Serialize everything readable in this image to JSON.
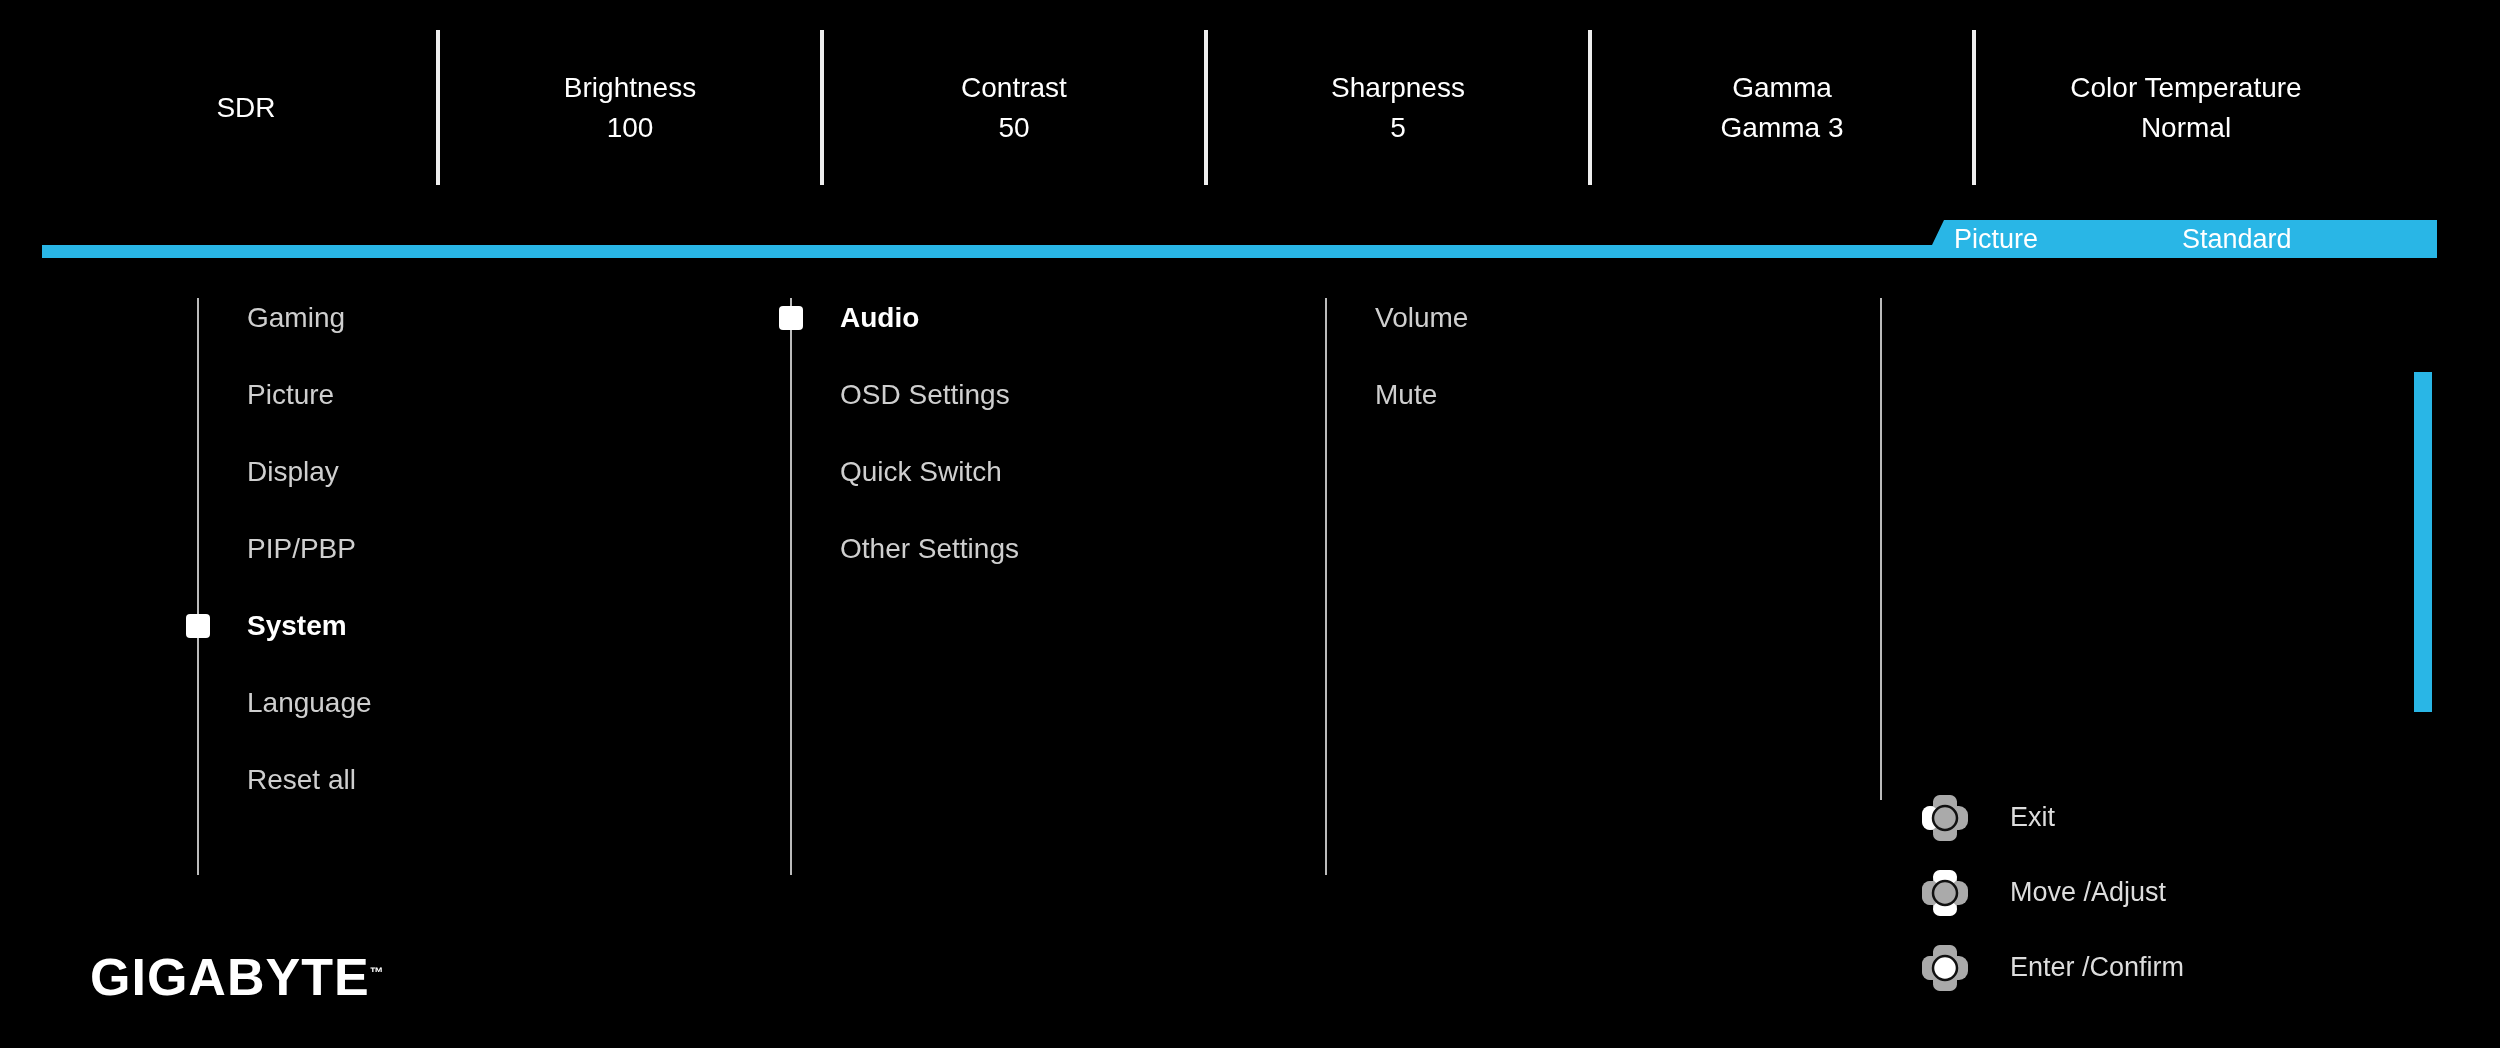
{
  "header": [
    {
      "label": "SDR"
    },
    {
      "label": "Brightness",
      "value": "100"
    },
    {
      "label": "Contrast",
      "value": "50"
    },
    {
      "label": "Sharpness",
      "value": "5"
    },
    {
      "label": "Gamma",
      "value": "Gamma 3"
    },
    {
      "label": "Color Temperature",
      "value": "Normal"
    }
  ],
  "mode_tab": {
    "label": "Picture",
    "value": "Standard"
  },
  "menu_columns": [
    {
      "items": [
        {
          "label": "Gaming",
          "selected": false
        },
        {
          "label": "Picture",
          "selected": false
        },
        {
          "label": "Display",
          "selected": false
        },
        {
          "label": "PIP/PBP",
          "selected": false
        },
        {
          "label": "System",
          "selected": true
        },
        {
          "label": "Language",
          "selected": false
        },
        {
          "label": "Reset all",
          "selected": false
        }
      ]
    },
    {
      "items": [
        {
          "label": "Audio",
          "selected": true
        },
        {
          "label": "OSD Settings",
          "selected": false
        },
        {
          "label": "Quick Switch",
          "selected": false
        },
        {
          "label": "Other Settings",
          "selected": false
        }
      ]
    },
    {
      "items": [
        {
          "label": "Volume",
          "selected": false
        },
        {
          "label": "Mute",
          "selected": false
        }
      ]
    }
  ],
  "hints": [
    {
      "kind": "left",
      "label": "Exit"
    },
    {
      "kind": "updown",
      "label": "Move /Adjust"
    },
    {
      "kind": "press",
      "label": "Enter /Confirm"
    }
  ],
  "logo": "GIGABYTE$^{™}$"
}
